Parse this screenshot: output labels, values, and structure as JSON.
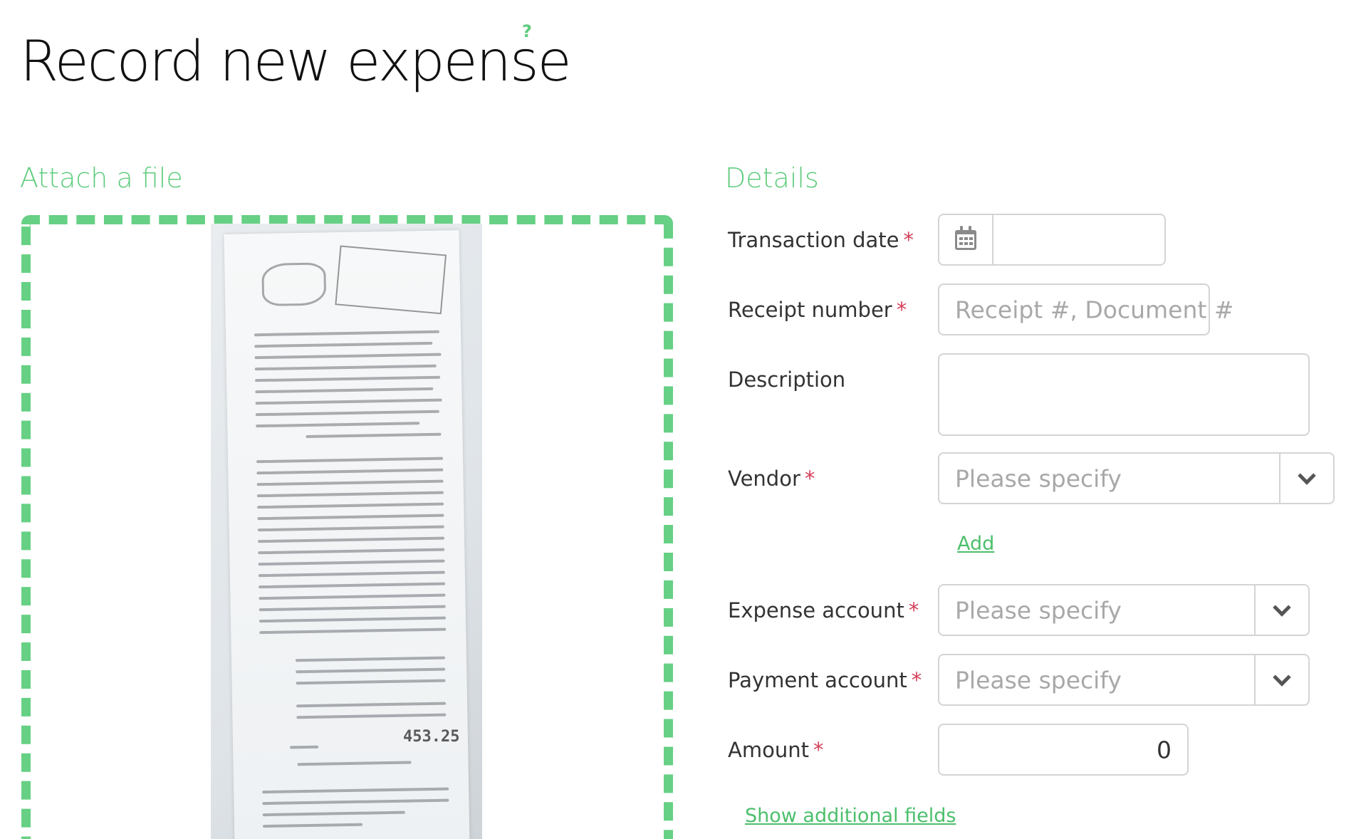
{
  "page": {
    "title": "Record new expense",
    "help_icon": "?"
  },
  "attach": {
    "title": "Attach a file",
    "receipt_total": "453.25"
  },
  "details": {
    "title": "Details",
    "transaction_date": {
      "label": "Transaction date",
      "required": "*",
      "value": ""
    },
    "receipt_number": {
      "label": "Receipt number",
      "required": "*",
      "placeholder": "Receipt #, Document #"
    },
    "description": {
      "label": "Description",
      "value": ""
    },
    "vendor": {
      "label": "Vendor",
      "required": "*",
      "placeholder": "Please specify",
      "add_link": "Add"
    },
    "expense_account": {
      "label": "Expense account",
      "required": "*",
      "placeholder": "Please specify"
    },
    "payment_account": {
      "label": "Payment account",
      "required": "*",
      "placeholder": "Please specify"
    },
    "amount": {
      "label": "Amount",
      "required": "*",
      "value": "0"
    },
    "show_more": "Show additional fields"
  },
  "colors": {
    "accent": "#5fcc7e",
    "required": "#d6405a",
    "border": "#d4d4d4"
  }
}
